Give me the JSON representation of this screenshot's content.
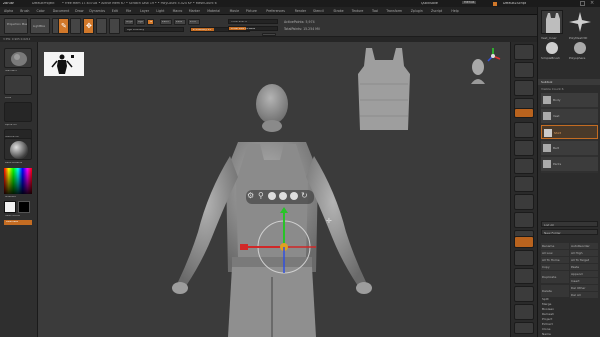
{
  "titlebar": {
    "app_name": "ZBrush",
    "project": "DefaultProject",
    "info": "• Free Mem 17.637GB • Active Mem 67 • Scratch Disk 19 • • PolyCount 5.424 KP • MeshCount 6",
    "quicksave": "QuickSave",
    "menus_label": "Menus",
    "default_script": "DefaultZScript"
  },
  "menubar": {
    "items": [
      "Alpha",
      "Brush",
      "Color",
      "Document",
      "Draw",
      "Dynamics",
      "Edit",
      "File",
      "Layer",
      "Light",
      "Macro",
      "Marker",
      "Material",
      "Movie",
      "Picture",
      "Preferences",
      "Render",
      "Stencil",
      "Stroke",
      "Texture",
      "Tool",
      "Transform",
      "Zplugin",
      "Zscript",
      "Help"
    ]
  },
  "toolbar": {
    "projection_master": "Projection Master",
    "lightbox": "LightBox",
    "quick_sketch": "Quick Sketch",
    "edit": "Edit",
    "draw": "Draw",
    "move": "Move",
    "scale": "Scale",
    "rotate": "Rotate",
    "mrgb": "Mrgb",
    "rgb": "Rgb",
    "m": "M",
    "zadd": "Zadd",
    "zsub": "Zsub",
    "zcut": "Zcut",
    "rgb_intensity": "Rgb Intensity",
    "z_intensity": "Z Intensity 25",
    "focal_shift": "Focal Shift 0",
    "draw_size": "Draw Size 78.4899",
    "dynamic": "Dynamic",
    "active_points": "ActivePoints: 5,974",
    "total_points": "TotalPoints: 15.254 Mil"
  },
  "statusline": {
    "text": "3 PW: 0.905 0.0211"
  },
  "left_shelf": {
    "items": [
      {
        "label": "Standard"
      },
      {
        "label": "Dots"
      },
      {
        "label": "Alpha Off"
      },
      {
        "label": "Texture Off"
      },
      {
        "label": "BasicMaterial"
      },
      {
        "label": "Gradient"
      },
      {
        "label": "SwitchColor"
      },
      {
        "label": "Alternate"
      }
    ]
  },
  "right_shelf": {
    "items": [
      "BPR",
      "SPix 3",
      "Scroll",
      "Zoom",
      "Actual",
      "AAHalf",
      "Dynamic Persp",
      "Floor",
      "L.Sym",
      "Frame",
      "Move",
      "ZoomD",
      "Rotate",
      "Line Fill PolyF",
      "Transp",
      "Ghost",
      "Solo",
      "Xpose"
    ]
  },
  "tray": {
    "thumbs": [
      {
        "label": "Vest_Inner"
      },
      {
        "label": "PolyMesh3D"
      },
      {
        "label": "SimpleBrush"
      },
      {
        "label": "Polysphere"
      }
    ],
    "subtool_header": "Subtool",
    "subtool_sub": "Visible Count 6",
    "subtools": [
      {
        "label": "Body"
      },
      {
        "label": "Vest"
      },
      {
        "label": "Shirt"
      },
      {
        "label": "Belt"
      },
      {
        "label": "Pants"
      }
    ],
    "list_all": "List All",
    "new_folder": "New Folder",
    "rows": [
      {
        "left": "Rename",
        "right": "AutoReorder"
      },
      {
        "left": "All Low",
        "right": "All High"
      },
      {
        "left": "All To Home",
        "right": "All To Target"
      },
      {
        "left": "Copy",
        "right": "Paste"
      },
      {
        "left": "Duplicate",
        "right": "Append"
      },
      {
        "left": "",
        "right": "Insert"
      },
      {
        "left": "Delete",
        "right": "Del Other"
      },
      {
        "left": "",
        "right": "Del All"
      }
    ],
    "list": [
      "Split",
      "Merge",
      "Boolean",
      "Remesh",
      "Project",
      "Extract",
      "Clone",
      "Name"
    ]
  },
  "gizmo": {
    "labels": [
      "gear",
      "link",
      "home",
      "center",
      "mask",
      "refresh",
      "lock"
    ]
  },
  "colors": {
    "accent": "#d1782a",
    "panel": "#2c2c2c",
    "viewport": "#3b3b3b",
    "model": "#8f8f8f"
  }
}
